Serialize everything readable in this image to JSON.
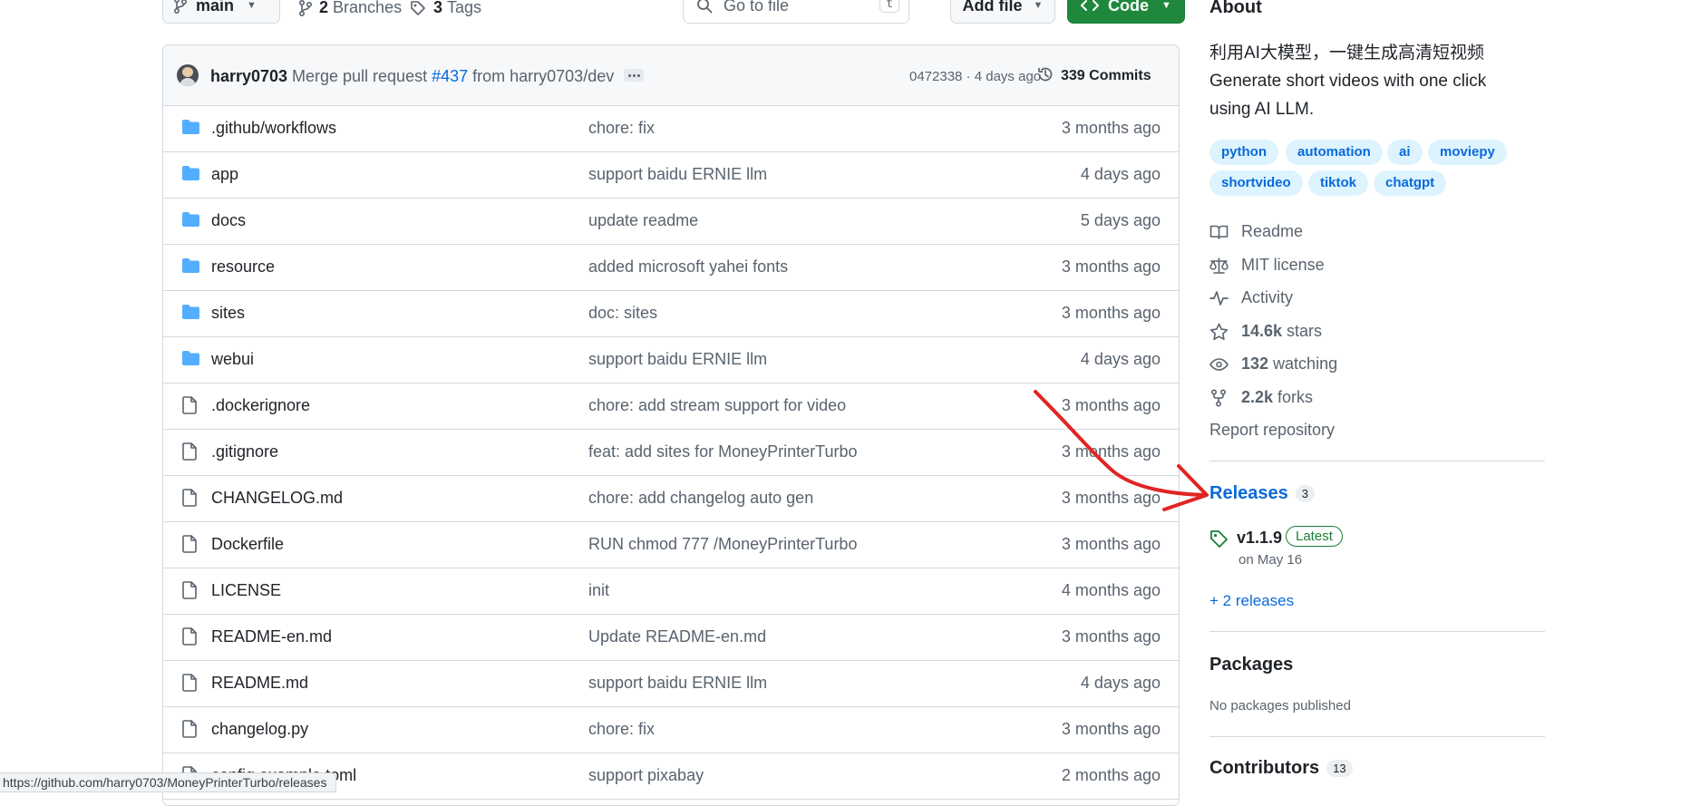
{
  "toolbar": {
    "branch": "main",
    "branches_count": "2",
    "branches_label": "Branches",
    "tags_count": "3",
    "tags_label": "Tags",
    "goto_placeholder": "Go to file",
    "goto_shortcut": "t",
    "add_file": "Add file",
    "code": "Code"
  },
  "commit": {
    "author": "harry0703",
    "message_prefix": "Merge pull request ",
    "pr": "#437",
    "message_suffix": " from harry0703/dev",
    "sha": "0472338",
    "time": " · 4 days ago",
    "commits": "339 Commits"
  },
  "files": [
    {
      "type": "folder",
      "name": ".github/workflows",
      "message": "chore: fix",
      "time": "3 months ago"
    },
    {
      "type": "folder",
      "name": "app",
      "message": "support baidu ERNIE llm",
      "time": "4 days ago"
    },
    {
      "type": "folder",
      "name": "docs",
      "message": "update readme",
      "time": "5 days ago"
    },
    {
      "type": "folder",
      "name": "resource",
      "message": "added microsoft yahei fonts",
      "time": "3 months ago"
    },
    {
      "type": "folder",
      "name": "sites",
      "message": "doc: sites",
      "time": "3 months ago"
    },
    {
      "type": "folder",
      "name": "webui",
      "message": "support baidu ERNIE llm",
      "time": "4 days ago"
    },
    {
      "type": "file",
      "name": ".dockerignore",
      "message": "chore: add stream support for video",
      "time": "3 months ago"
    },
    {
      "type": "file",
      "name": ".gitignore",
      "message": "feat: add sites for MoneyPrinterTurbo",
      "time": "3 months ago"
    },
    {
      "type": "file",
      "name": "CHANGELOG.md",
      "message": "chore: add changelog auto gen",
      "time": "3 months ago"
    },
    {
      "type": "file",
      "name": "Dockerfile",
      "message": "RUN chmod 777 /MoneyPrinterTurbo",
      "time": "3 months ago"
    },
    {
      "type": "file",
      "name": "LICENSE",
      "message": "init",
      "time": "4 months ago"
    },
    {
      "type": "file",
      "name": "README-en.md",
      "message": "Update README-en.md",
      "time": "3 months ago"
    },
    {
      "type": "file",
      "name": "README.md",
      "message": "support baidu ERNIE llm",
      "time": "4 days ago"
    },
    {
      "type": "file",
      "name": "changelog.py",
      "message": "chore: fix",
      "time": "3 months ago"
    },
    {
      "type": "file",
      "name": "config.example.toml",
      "message": "support pixabay",
      "time": "2 months ago"
    }
  ],
  "about": {
    "title": "About",
    "desc_zh": "利用AI大模型，一键生成高清短视频",
    "desc_en_1": "Generate short videos with one click",
    "desc_en_2": "using AI LLM.",
    "topics": [
      "python",
      "automation",
      "ai",
      "moviepy",
      "shortvideo",
      "tiktok",
      "chatgpt"
    ],
    "readme": "Readme",
    "license": "MIT license",
    "activity": "Activity",
    "stars_count": "14.6k",
    "stars_label": " stars",
    "watching_count": "132",
    "watching_label": " watching",
    "forks_count": "2.2k",
    "forks_label": " forks",
    "report": "Report repository"
  },
  "releases": {
    "title": "Releases",
    "count": "3",
    "version": "v1.1.9",
    "latest_badge": "Latest",
    "date": "on May 16",
    "more": "+ 2 releases"
  },
  "packages": {
    "title": "Packages",
    "empty": "No packages published"
  },
  "contributors": {
    "title": "Contributors",
    "count": "13"
  },
  "status_bar": {
    "url": "https://github.com/harry0703/MoneyPrinterTurbo/releases"
  },
  "colors": {
    "link": "#0969da",
    "folder": "#54aeff",
    "green": "#1f883d",
    "annotation_arrow": "#e02424"
  }
}
